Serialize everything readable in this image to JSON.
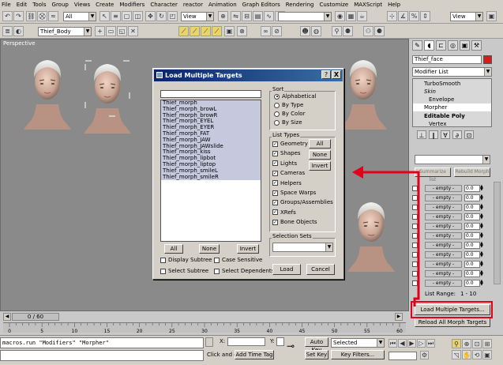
{
  "menu": [
    "File",
    "Edit",
    "Tools",
    "Group",
    "Views",
    "Create",
    "Modifiers",
    "Character",
    "reactor",
    "Animation",
    "Graph Editors",
    "Rendering",
    "Customize",
    "MAXScript",
    "Help"
  ],
  "toolbar": {
    "selection_filter": "All",
    "ref_coord": "View",
    "ref_coord2": "View",
    "layer": "Thief_Body"
  },
  "viewport": {
    "label": "Perspective"
  },
  "dialog": {
    "title": "Load Multiple Targets",
    "search_value": "",
    "targets": [
      "Thief_morph",
      "Thief_morph_browL",
      "Thief_morph_browR",
      "Thief_morph_EYEL",
      "Thief_morph_EYER",
      "Thief_morph_FAT",
      "Thief_morph_JAW",
      "Thief_morph_JAWslide",
      "Thief_morph_kiss",
      "Thief_morph_lipbot",
      "Thief_morph_liptop",
      "Thief_morph_smileL",
      "Thief_morph_smileR"
    ],
    "sort_label": "Sort",
    "sort_options": [
      "Alphabetical",
      "By Type",
      "By Color",
      "By Size"
    ],
    "list_types_label": "List Types",
    "list_types": [
      "Geometry",
      "Shapes",
      "Lights",
      "Cameras",
      "Helpers",
      "Space Warps",
      "Groups/Assemblies",
      "XRefs",
      "Bone Objects"
    ],
    "lt_all": "All",
    "lt_none": "None",
    "lt_invert": "Invert",
    "selection_sets_label": "Selection Sets",
    "all": "All",
    "none": "None",
    "invert": "Invert",
    "display_subtree": "Display Subtree",
    "case_sensitive": "Case Sensitive",
    "select_subtree": "Select Subtree",
    "select_dependents": "Select Dependents",
    "load": "Load",
    "cancel": "Cancel",
    "help_btn": "?",
    "close_btn": "X"
  },
  "panel": {
    "object_name": "Thief_face",
    "modifier_list": "Modifier List",
    "stack": [
      "TurboSmooth",
      "Skin",
      "Envelope",
      "Morpher",
      "Editable Poly",
      "Vertex"
    ],
    "channel_label": "- empty -",
    "channel_value": "0.0",
    "channel_count": 11,
    "list_range_label": "List Range:",
    "list_range_value": "1 - 10",
    "load_multiple": "Load Multiple Targets...",
    "reload_all": "Reload All Morph Targets",
    "summarize": "Summarize list",
    "rebuild": "Rebuild Morph"
  },
  "timeline": {
    "frame": "0 / 60",
    "ticks": [
      "0",
      "5",
      "10",
      "15",
      "20",
      "25",
      "30",
      "35",
      "40",
      "45",
      "50",
      "55",
      "60"
    ]
  },
  "status": {
    "script": "macros.run \"Modifiers\" \"Morpher\"",
    "click_text": "Click and d",
    "add_time_tag": "Add Time Tag",
    "x_label": "X:",
    "y_label": "Y:",
    "auto_key": "Auto Key",
    "set_key": "Set Key",
    "key_mode": "Selected",
    "key_filters": "Key Filters..."
  },
  "colors": {
    "highlight": "#e2001a",
    "title_start": "#0a246a",
    "title_end": "#3a6ea5"
  }
}
